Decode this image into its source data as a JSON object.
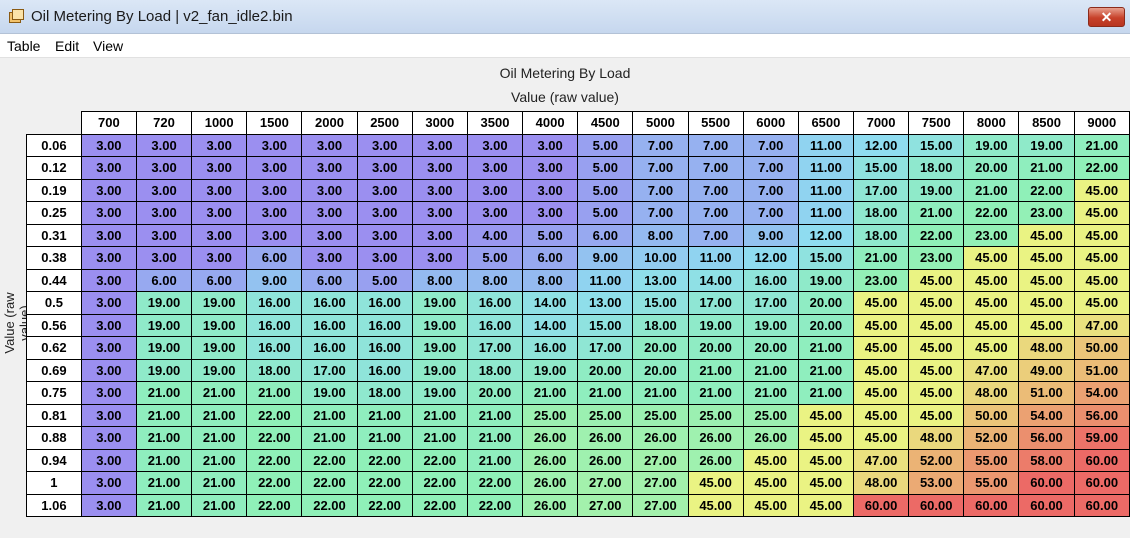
{
  "window": {
    "title": "Oil Metering By Load | v2_fan_idle2.bin",
    "close_label": "✕"
  },
  "menu": {
    "items": [
      "Table",
      "Edit",
      "View"
    ]
  },
  "table": {
    "title": "Oil Metering By Load",
    "value_label": "Value (raw value)",
    "y_axis_label": "Value (raw value)",
    "columns": [
      "700",
      "720",
      "1000",
      "1500",
      "2000",
      "2500",
      "3000",
      "3500",
      "4000",
      "4500",
      "5000",
      "5500",
      "6000",
      "6500",
      "7000",
      "7500",
      "8000",
      "8500",
      "9000"
    ],
    "rows": [
      {
        "label": "0.06",
        "values": [
          "3.00",
          "3.00",
          "3.00",
          "3.00",
          "3.00",
          "3.00",
          "3.00",
          "3.00",
          "3.00",
          "5.00",
          "7.00",
          "7.00",
          "7.00",
          "11.00",
          "12.00",
          "15.00",
          "19.00",
          "19.00",
          "21.00"
        ]
      },
      {
        "label": "0.12",
        "values": [
          "3.00",
          "3.00",
          "3.00",
          "3.00",
          "3.00",
          "3.00",
          "3.00",
          "3.00",
          "3.00",
          "5.00",
          "7.00",
          "7.00",
          "7.00",
          "11.00",
          "15.00",
          "18.00",
          "20.00",
          "21.00",
          "22.00"
        ]
      },
      {
        "label": "0.19",
        "values": [
          "3.00",
          "3.00",
          "3.00",
          "3.00",
          "3.00",
          "3.00",
          "3.00",
          "3.00",
          "3.00",
          "5.00",
          "7.00",
          "7.00",
          "7.00",
          "11.00",
          "17.00",
          "19.00",
          "21.00",
          "22.00",
          "45.00"
        ]
      },
      {
        "label": "0.25",
        "values": [
          "3.00",
          "3.00",
          "3.00",
          "3.00",
          "3.00",
          "3.00",
          "3.00",
          "3.00",
          "3.00",
          "5.00",
          "7.00",
          "7.00",
          "7.00",
          "11.00",
          "18.00",
          "21.00",
          "22.00",
          "23.00",
          "45.00"
        ]
      },
      {
        "label": "0.31",
        "values": [
          "3.00",
          "3.00",
          "3.00",
          "3.00",
          "3.00",
          "3.00",
          "3.00",
          "4.00",
          "5.00",
          "6.00",
          "8.00",
          "7.00",
          "9.00",
          "12.00",
          "18.00",
          "22.00",
          "23.00",
          "45.00",
          "45.00"
        ]
      },
      {
        "label": "0.38",
        "values": [
          "3.00",
          "3.00",
          "3.00",
          "6.00",
          "3.00",
          "3.00",
          "3.00",
          "5.00",
          "6.00",
          "9.00",
          "10.00",
          "11.00",
          "12.00",
          "15.00",
          "21.00",
          "23.00",
          "45.00",
          "45.00",
          "45.00"
        ]
      },
      {
        "label": "0.44",
        "values": [
          "3.00",
          "6.00",
          "6.00",
          "9.00",
          "6.00",
          "5.00",
          "8.00",
          "8.00",
          "8.00",
          "11.00",
          "13.00",
          "14.00",
          "16.00",
          "19.00",
          "23.00",
          "45.00",
          "45.00",
          "45.00",
          "45.00"
        ]
      },
      {
        "label": "0.5",
        "values": [
          "3.00",
          "19.00",
          "19.00",
          "16.00",
          "16.00",
          "16.00",
          "19.00",
          "16.00",
          "14.00",
          "13.00",
          "15.00",
          "17.00",
          "17.00",
          "20.00",
          "45.00",
          "45.00",
          "45.00",
          "45.00",
          "45.00"
        ]
      },
      {
        "label": "0.56",
        "values": [
          "3.00",
          "19.00",
          "19.00",
          "16.00",
          "16.00",
          "16.00",
          "19.00",
          "16.00",
          "14.00",
          "15.00",
          "18.00",
          "19.00",
          "19.00",
          "20.00",
          "45.00",
          "45.00",
          "45.00",
          "45.00",
          "47.00"
        ]
      },
      {
        "label": "0.62",
        "values": [
          "3.00",
          "19.00",
          "19.00",
          "16.00",
          "16.00",
          "16.00",
          "19.00",
          "17.00",
          "16.00",
          "17.00",
          "20.00",
          "20.00",
          "20.00",
          "21.00",
          "45.00",
          "45.00",
          "45.00",
          "48.00",
          "50.00"
        ]
      },
      {
        "label": "0.69",
        "values": [
          "3.00",
          "19.00",
          "19.00",
          "18.00",
          "17.00",
          "16.00",
          "19.00",
          "18.00",
          "19.00",
          "20.00",
          "20.00",
          "21.00",
          "21.00",
          "21.00",
          "45.00",
          "45.00",
          "47.00",
          "49.00",
          "51.00"
        ]
      },
      {
        "label": "0.75",
        "values": [
          "3.00",
          "21.00",
          "21.00",
          "21.00",
          "19.00",
          "18.00",
          "19.00",
          "20.00",
          "21.00",
          "21.00",
          "21.00",
          "21.00",
          "21.00",
          "21.00",
          "45.00",
          "45.00",
          "48.00",
          "51.00",
          "54.00"
        ]
      },
      {
        "label": "0.81",
        "values": [
          "3.00",
          "21.00",
          "21.00",
          "22.00",
          "21.00",
          "21.00",
          "21.00",
          "21.00",
          "25.00",
          "25.00",
          "25.00",
          "25.00",
          "25.00",
          "45.00",
          "45.00",
          "45.00",
          "50.00",
          "54.00",
          "56.00"
        ]
      },
      {
        "label": "0.88",
        "values": [
          "3.00",
          "21.00",
          "21.00",
          "22.00",
          "21.00",
          "21.00",
          "21.00",
          "21.00",
          "26.00",
          "26.00",
          "26.00",
          "26.00",
          "26.00",
          "45.00",
          "45.00",
          "48.00",
          "52.00",
          "56.00",
          "59.00"
        ]
      },
      {
        "label": "0.94",
        "values": [
          "3.00",
          "21.00",
          "21.00",
          "22.00",
          "22.00",
          "22.00",
          "22.00",
          "21.00",
          "26.00",
          "26.00",
          "27.00",
          "26.00",
          "45.00",
          "45.00",
          "47.00",
          "52.00",
          "55.00",
          "58.00",
          "60.00"
        ]
      },
      {
        "label": "1",
        "values": [
          "3.00",
          "21.00",
          "21.00",
          "22.00",
          "22.00",
          "22.00",
          "22.00",
          "22.00",
          "26.00",
          "27.00",
          "27.00",
          "45.00",
          "45.00",
          "45.00",
          "48.00",
          "53.00",
          "55.00",
          "60.00",
          "60.00"
        ]
      },
      {
        "label": "1.06",
        "values": [
          "3.00",
          "21.00",
          "21.00",
          "22.00",
          "22.00",
          "22.00",
          "22.00",
          "22.00",
          "26.00",
          "27.00",
          "27.00",
          "45.00",
          "45.00",
          "45.00",
          "60.00",
          "60.00",
          "60.00",
          "60.00",
          "60.00"
        ]
      }
    ]
  },
  "colors": {
    "heatmap_low": "#9b8ff0",
    "heatmap_mid": "#8ff0b8",
    "heatmap_high_mid": "#eaf383",
    "heatmap_high": "#ec6a66"
  }
}
